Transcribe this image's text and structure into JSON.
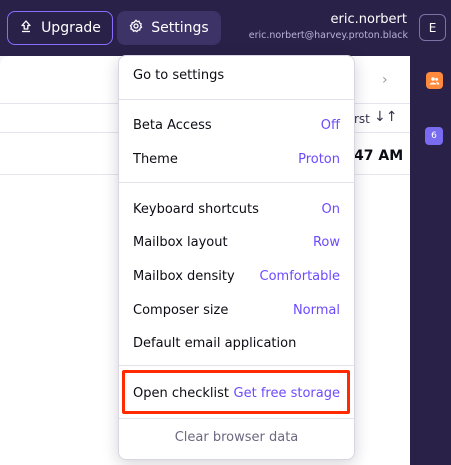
{
  "header": {
    "upgrade_label": "Upgrade",
    "settings_label": "Settings",
    "user_name": "eric.norbert",
    "user_email": "eric.norbert@harvey.proton.black",
    "avatar_initial": "E"
  },
  "sidebar": {
    "calendar_day": "6"
  },
  "list": {
    "sort_text": "rst",
    "time_text": "47 AM"
  },
  "menu": {
    "go_to_settings": "Go to settings",
    "items_group1": [
      {
        "label": "Beta Access",
        "value": "Off"
      },
      {
        "label": "Theme",
        "value": "Proton"
      }
    ],
    "items_group2": [
      {
        "label": "Keyboard shortcuts",
        "value": "On"
      },
      {
        "label": "Mailbox layout",
        "value": "Row"
      },
      {
        "label": "Mailbox density",
        "value": "Comfortable"
      },
      {
        "label": "Composer size",
        "value": "Normal"
      },
      {
        "label": "Default email application",
        "value": ""
      }
    ],
    "checklist": {
      "label": "Open checklist",
      "value": "Get free storage"
    },
    "clear_browser_data": "Clear browser data"
  },
  "colors": {
    "header_bg": "#2a2148",
    "accent": "#6d4aff",
    "highlight_border": "#ff2a00"
  }
}
